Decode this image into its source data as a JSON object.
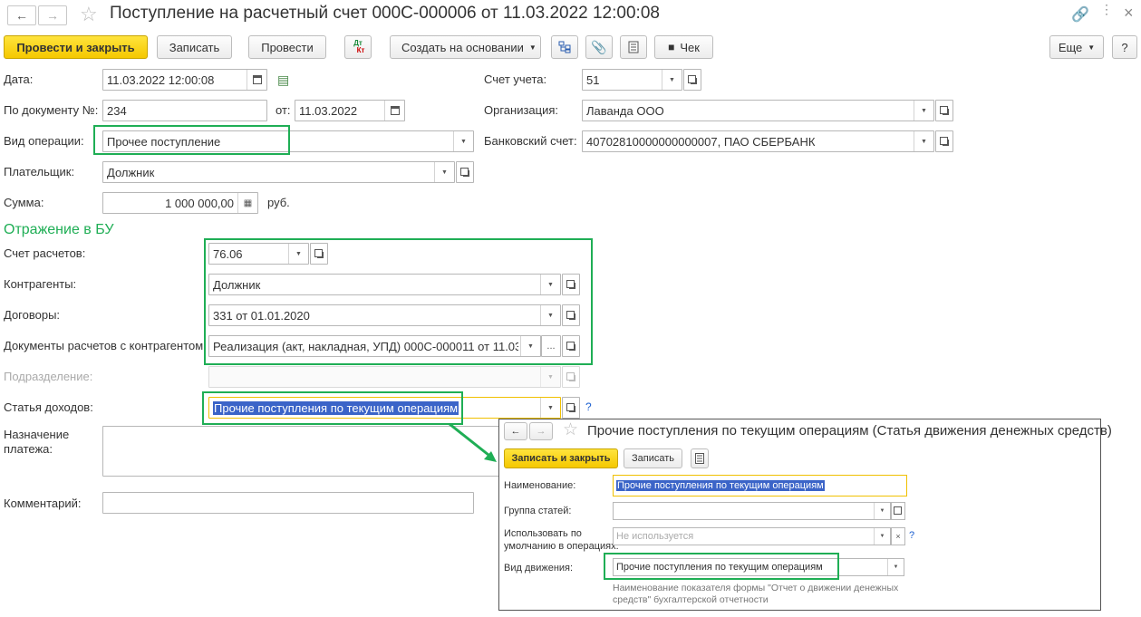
{
  "window": {
    "title": "Поступление на расчетный счет 000С-000006 от 11.03.2022 12:00:08",
    "back_icon": "arrow-left-icon",
    "forward_icon": "arrow-right-icon",
    "star_icon": "star-icon",
    "link_icon": "link-icon",
    "more_icon": "vertical-dots-icon",
    "close_icon": "close-icon"
  },
  "toolbar": {
    "post_close": "Провести и закрыть",
    "save": "Записать",
    "post": "Провести",
    "dtkt_top": "Дт",
    "dtkt_bottom": "Кт",
    "create_based": "Создать на основании",
    "check": "Чек",
    "more": "Еще",
    "help": "?"
  },
  "form": {
    "date_label": "Дата:",
    "date_value": "11.03.2022 12:00:08",
    "docnum_label": "По документу №:",
    "docnum_value": "234",
    "from_label": "от:",
    "from_value": "11.03.2022",
    "optype_label": "Вид операции:",
    "optype_value": "Прочее поступление",
    "payer_label": "Плательщик:",
    "payer_value": "Должник",
    "sum_label": "Сумма:",
    "sum_value": "1 000 000,00",
    "sum_currency": "руб.",
    "account_label": "Счет учета:",
    "account_value": "51",
    "org_label": "Организация:",
    "org_value": "Лаванда ООО",
    "bank_label": "Банковский счет:",
    "bank_value": "40702810000000000007, ПАО СБЕРБАНК"
  },
  "accounting": {
    "section_title": "Отражение в БУ",
    "settle_label": "Счет расчетов:",
    "settle_value": "76.06",
    "contractors_label": "Контрагенты:",
    "contractors_value": "Должник",
    "contracts_label": "Договоры:",
    "contracts_value": "331 от 01.01.2020",
    "docs_label": "Документы расчетов с контрагентом:",
    "docs_value": "Реализация (акт, накладная, УПД) 000С-000011 от 11.03...",
    "division_label": "Подразделение:",
    "income_label": "Статья доходов:",
    "income_value": "Прочие поступления по текущим операциям",
    "income_help": "?",
    "purpose_label_1": "Назначение",
    "purpose_label_2": "платежа:",
    "comment_label": "Комментарий:"
  },
  "popup": {
    "title": "Прочие поступления по текущим операциям (Статья движения денежных средств)",
    "save_close": "Записать и закрыть",
    "save": "Записать",
    "name_label": "Наименование:",
    "name_value": "Прочие поступления по текущим операциям",
    "group_label": "Группа статей:",
    "default_label_1": "Использовать по",
    "default_label_2": "умолчанию в операциях:",
    "default_placeholder": "Не используется",
    "default_help": "?",
    "movement_label": "Вид движения:",
    "movement_value": "Прочие поступления по текущим операциям",
    "note_1": "Наименование показателя формы \"Отчет о движении денежных",
    "note_2": "средств\" бухгалтерской отчетности"
  },
  "colors": {
    "highlight": "#1fae55",
    "primary_button": "#f5c800",
    "section_title": "#1fae55",
    "selection": "#3b64c8"
  }
}
